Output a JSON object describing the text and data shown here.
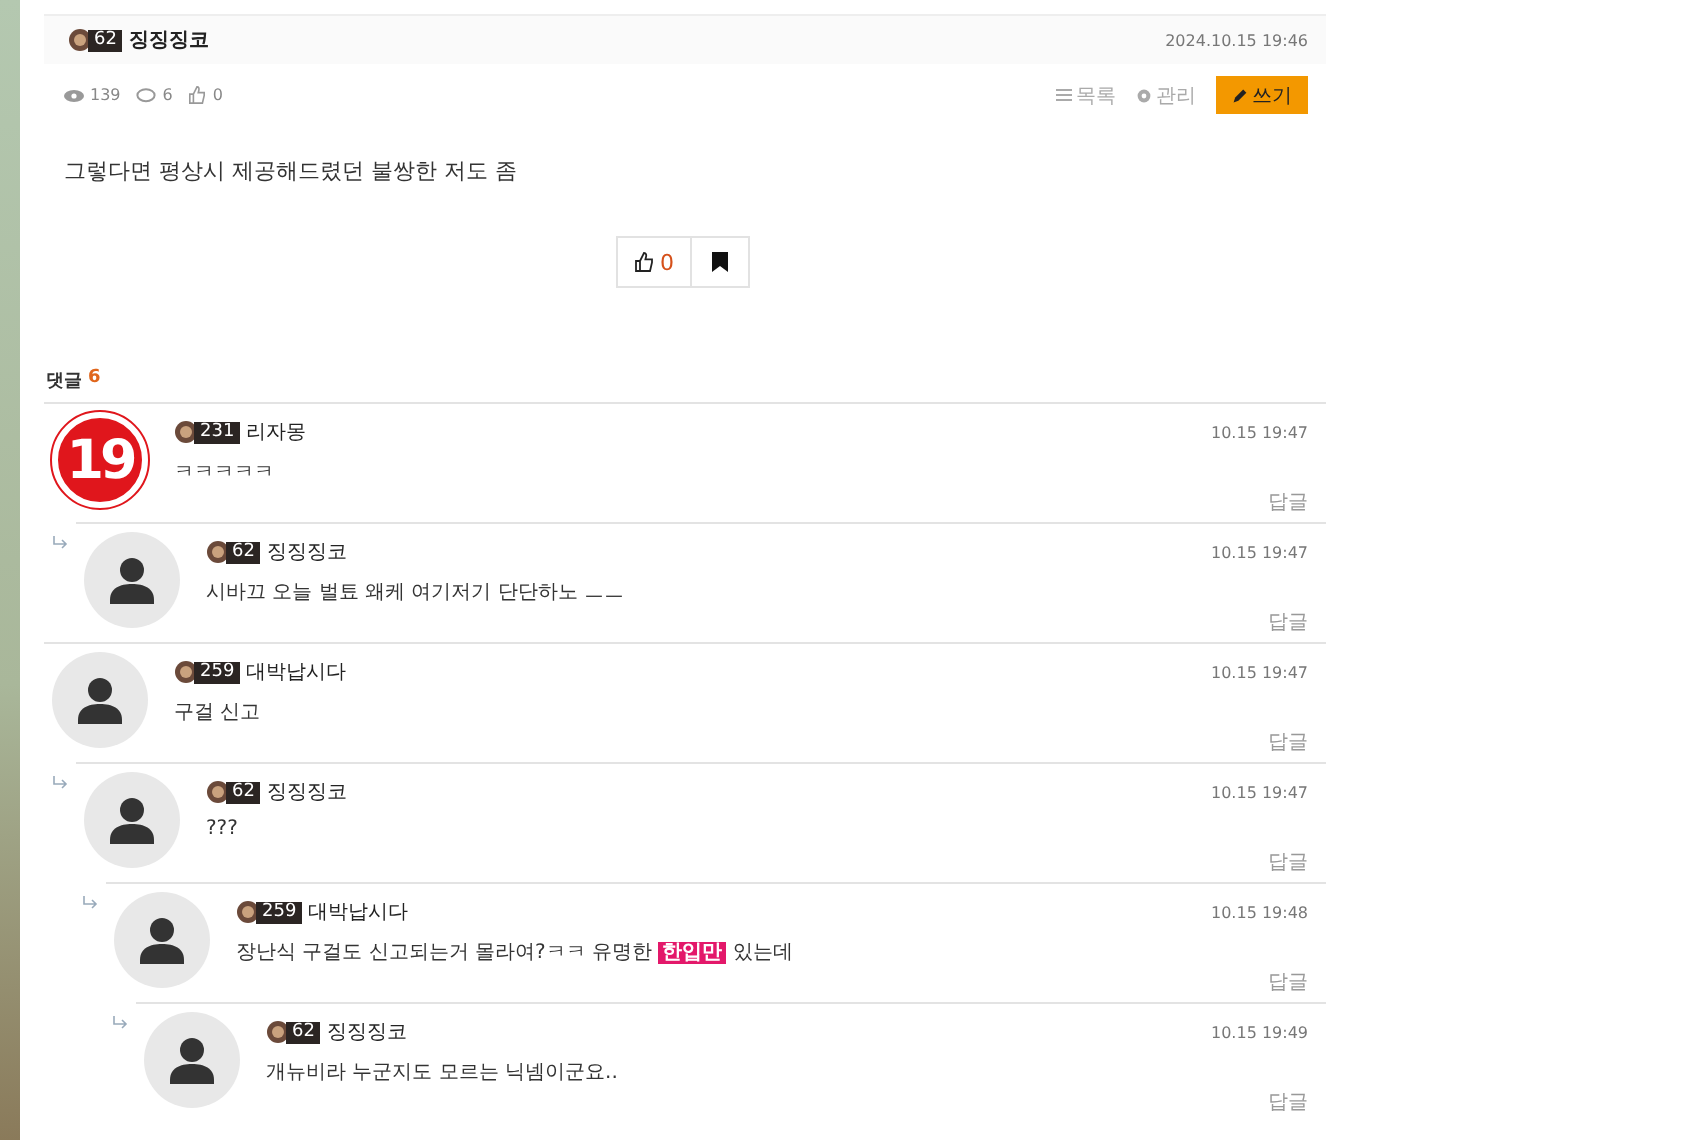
{
  "post": {
    "author": {
      "level": "62",
      "name": "징징징코"
    },
    "date": "2024.10.15 19:46",
    "stats": {
      "views": "139",
      "comments": "6",
      "likes": "0"
    },
    "actions": [
      {
        "kind": "list",
        "label": "목록"
      },
      {
        "kind": "manage",
        "label": "관리"
      },
      {
        "kind": "write",
        "label": "쓰기"
      }
    ],
    "body": "그렇다면 평상시 제공해드렸던 불쌍한 저도 좀",
    "like_count": "0"
  },
  "comments_header": {
    "label": "댓글",
    "count": "6"
  },
  "comments": [
    {
      "level": "231",
      "name": "리자몽",
      "time": "10.15 19:47",
      "avatar": {
        "kind": "badge",
        "text": "19"
      },
      "content": [
        {
          "text": "ㅋㅋㅋㅋㅋ",
          "highlighted": false
        }
      ],
      "reply_label": "답글",
      "children": [
        {
          "level": "62",
          "name": "징징징코",
          "time": "10.15 19:47",
          "avatar": {
            "kind": "default"
          },
          "content": [
            {
              "text": "시바끄 오늘 벌툐 왜케 여기저기 단단하노 ㅡㅡ",
              "highlighted": false
            }
          ],
          "reply_label": "답글"
        }
      ]
    },
    {
      "level": "259",
      "name": "대박납시다",
      "time": "10.15 19:47",
      "avatar": {
        "kind": "default"
      },
      "content": [
        {
          "text": "구걸 신고",
          "highlighted": false
        }
      ],
      "reply_label": "답글",
      "children": [
        {
          "level": "62",
          "name": "징징징코",
          "time": "10.15 19:47",
          "avatar": {
            "kind": "default"
          },
          "content": [
            {
              "text": "???",
              "highlighted": false
            }
          ],
          "reply_label": "답글",
          "children": [
            {
              "level": "259",
              "name": "대박납시다",
              "time": "10.15 19:48",
              "avatar": {
                "kind": "default"
              },
              "content": [
                {
                  "text": "장난식 구걸도 신고되는거 몰라여?ㅋㅋ 유명한 ",
                  "highlighted": false
                },
                {
                  "text": "한입만",
                  "highlighted": true
                },
                {
                  "text": " 있는데",
                  "highlighted": false
                }
              ],
              "reply_label": "답글",
              "children": [
                {
                  "level": "62",
                  "name": "징징징코",
                  "time": "10.15 19:49",
                  "avatar": {
                    "kind": "default"
                  },
                  "content": [
                    {
                      "text": "개뉴비라 누군지도 모르는 닉넴이군요..",
                      "highlighted": false
                    }
                  ],
                  "reply_label": "답글"
                }
              ]
            }
          ]
        }
      ]
    }
  ]
}
